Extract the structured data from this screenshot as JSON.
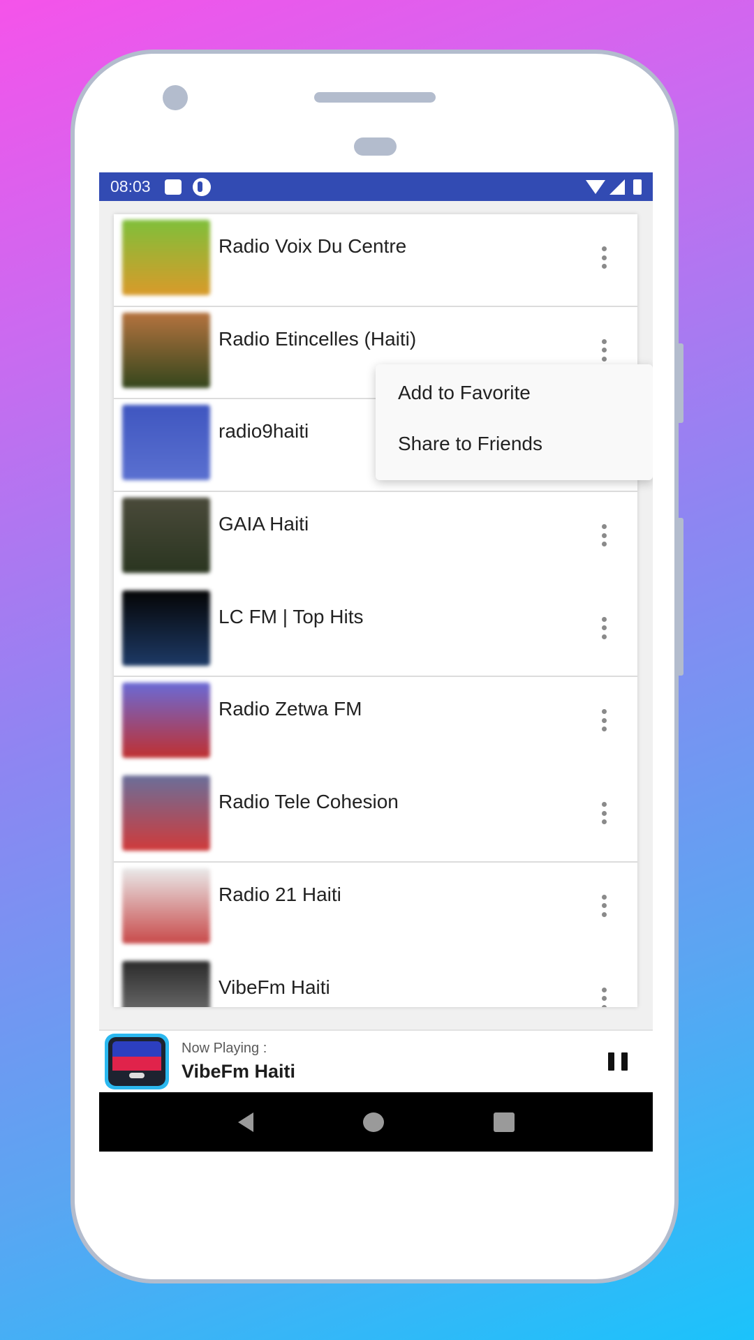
{
  "status_bar": {
    "time": "08:03",
    "left_icons": [
      "notification-square-icon",
      "app-circle-icon"
    ],
    "right_icons": [
      "wifi-icon",
      "signal-icon",
      "battery-icon"
    ]
  },
  "stations": [
    {
      "name": "Radio Voix Du Centre",
      "thumb_colors": [
        "#7fbf3a",
        "#d99a2a"
      ],
      "divider": true
    },
    {
      "name": "Radio Etincelles (Haiti)",
      "thumb_colors": [
        "#b5733f",
        "#34461c"
      ],
      "divider": true
    },
    {
      "name": "radio9haiti",
      "thumb_colors": [
        "#3f56c0",
        "#5a70d0"
      ],
      "divider": true
    },
    {
      "name": "GAIA Haiti",
      "thumb_colors": [
        "#4a4a3a",
        "#2a3520"
      ],
      "divider": false
    },
    {
      "name": "LC FM | Top Hits",
      "thumb_colors": [
        "#050505",
        "#1d3a66"
      ],
      "divider": true
    },
    {
      "name": "Radio Zetwa FM",
      "thumb_colors": [
        "#6a6ad6",
        "#c03030"
      ],
      "divider": false
    },
    {
      "name": "Radio Tele Cohesion",
      "thumb_colors": [
        "#6a6f9a",
        "#d03a3a"
      ],
      "divider": true
    },
    {
      "name": "Radio 21 Haiti",
      "thumb_colors": [
        "#e9e9e9",
        "#c84a4a"
      ],
      "divider": false
    },
    {
      "name": "VibeFm Haiti",
      "thumb_colors": [
        "#2a2a2a",
        "#888888"
      ],
      "divider": false
    }
  ],
  "context_menu": {
    "items": [
      "Add to Favorite",
      "Share to Friends"
    ]
  },
  "now_playing": {
    "label": "Now Playing :",
    "title": "VibeFm Haiti",
    "state": "playing"
  },
  "colors": {
    "status_bar": "#324bb3",
    "accent_logo": "#2bb8ef"
  }
}
